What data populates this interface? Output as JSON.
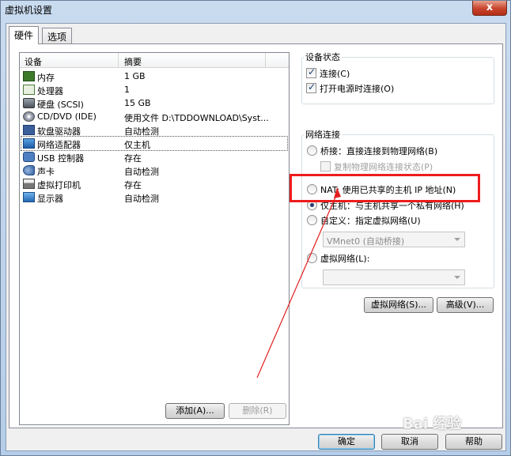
{
  "window": {
    "title": "虚拟机设置",
    "close_glyph": "x"
  },
  "tabs": [
    {
      "label": "硬件",
      "active": true
    },
    {
      "label": "选项",
      "active": false
    }
  ],
  "device_list": {
    "columns": [
      "设备",
      "摘要"
    ],
    "rows": [
      {
        "icon": "memory-icon",
        "device": "内存",
        "summary": "1 GB"
      },
      {
        "icon": "processor-icon",
        "device": "处理器",
        "summary": "1"
      },
      {
        "icon": "hard-disk-icon",
        "device": "硬盘 (SCSI)",
        "summary": "15 GB"
      },
      {
        "icon": "cd-dvd-icon",
        "device": "CD/DVD (IDE)",
        "summary": "使用文件 D:\\TDDOWNLOAD\\Syst..."
      },
      {
        "icon": "floppy-icon",
        "device": "软盘驱动器",
        "summary": "自动检测"
      },
      {
        "icon": "network-adapter-icon",
        "device": "网络适配器",
        "summary": "仅主机",
        "selected": true
      },
      {
        "icon": "usb-icon",
        "device": "USB 控制器",
        "summary": "存在"
      },
      {
        "icon": "sound-card-icon",
        "device": "声卡",
        "summary": "自动检测"
      },
      {
        "icon": "printer-icon",
        "device": "虚拟打印机",
        "summary": "存在"
      },
      {
        "icon": "display-icon",
        "device": "显示器",
        "summary": "自动检测"
      }
    ],
    "add_button": "添加(A)...",
    "remove_button": "删除(R)"
  },
  "device_status": {
    "title": "设备状态",
    "connected": {
      "label": "连接(C)",
      "checked": true
    },
    "connect_at_power_on": {
      "label": "打开电源时连接(O)",
      "checked": true
    }
  },
  "network": {
    "title": "网络连接",
    "bridged": {
      "label": "桥接：直接连接到物理网络(B)",
      "checked": false
    },
    "replicate": {
      "label": "复制物理网络连接状态(P)",
      "checked": false,
      "disabled": true
    },
    "nat": {
      "label": "NAT: 使用已共享的主机 IP 地址(N)",
      "checked": false
    },
    "host_only": {
      "label": "仅主机：与主机共享一个私有网络(H)",
      "checked": true
    },
    "custom": {
      "label": "自定义：指定虚拟网络(U)",
      "checked": false
    },
    "custom_select": "VMnet0 (自动桥接)",
    "lan_segment": {
      "label": "虚拟网络(L):",
      "checked": false
    },
    "lan_select": "",
    "virtual_network_button": "虚拟网络(S)...",
    "advanced_button": "高级(V)..."
  },
  "footer": {
    "ok": "确定",
    "cancel": "取消",
    "help": "帮助"
  },
  "annotation": {
    "highlight_color": "#ee1c1c"
  },
  "watermark": "Bai 经验"
}
